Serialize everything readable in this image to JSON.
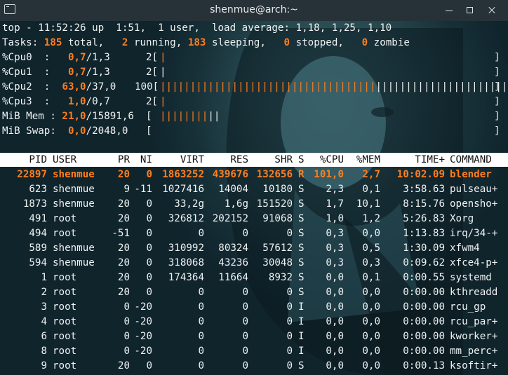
{
  "window": {
    "title": "shenmue@arch:~"
  },
  "summary": {
    "line1": "top - 11:52:26 up  1:51,  1 user,  load average: 1,18, 1,25, 1,10",
    "tasks_label": "Tasks:",
    "tasks_total": "185",
    "tasks_total_label": "total,",
    "tasks_running": "2",
    "tasks_running_label": "running,",
    "tasks_sleeping": "183",
    "tasks_sleeping_label": "sleeping,",
    "tasks_stopped": "0",
    "tasks_stopped_label": "stopped,",
    "tasks_zombie": "0",
    "tasks_zombie_label": "zombie"
  },
  "cpus": [
    {
      "label": "%Cpu0  :",
      "val": "0,7",
      "rest": "/1,3",
      "total": "2",
      "usage_pct": 2
    },
    {
      "label": "%Cpu1  :",
      "val": "0,7",
      "rest": "/1,3",
      "total": "2",
      "usage_pct": 2
    },
    {
      "label": "%Cpu2  :",
      "val": "63,0",
      "rest": "/37,0",
      "total": "100",
      "usage_pct": 100
    },
    {
      "label": "%Cpu3  :",
      "val": "1,0",
      "rest": "/0,7",
      "total": "2",
      "usage_pct": 2
    }
  ],
  "mem": {
    "label": "MiB Mem :",
    "val": "21,0",
    "rest": "/15891,6"
  },
  "swap": {
    "label": "MiB Swap:",
    "val": "0,0",
    "rest": "/2048,0"
  },
  "columns": [
    "PID",
    "USER",
    "PR",
    "NI",
    "VIRT",
    "RES",
    "SHR",
    "S",
    "%CPU",
    "%MEM",
    "TIME+",
    "COMMAND"
  ],
  "processes": [
    [
      "22897",
      "shenmue",
      "20",
      "0",
      "1863252",
      "439676",
      "132656",
      "R",
      "101,0",
      "2,7",
      "10:02.09",
      "blender"
    ],
    [
      "623",
      "shenmue",
      "9",
      "-11",
      "1027416",
      "14004",
      "10180",
      "S",
      "2,3",
      "0,1",
      "3:58.63",
      "pulseau+"
    ],
    [
      "1873",
      "shenmue",
      "20",
      "0",
      "33,2g",
      "1,6g",
      "151520",
      "S",
      "1,7",
      "10,1",
      "8:15.76",
      "opensho+"
    ],
    [
      "491",
      "root",
      "20",
      "0",
      "326812",
      "202152",
      "91068",
      "S",
      "1,0",
      "1,2",
      "5:26.83",
      "Xorg"
    ],
    [
      "494",
      "root",
      "-51",
      "0",
      "0",
      "0",
      "0",
      "S",
      "0,3",
      "0,0",
      "1:13.83",
      "irq/34-+"
    ],
    [
      "589",
      "shenmue",
      "20",
      "0",
      "310992",
      "80324",
      "57612",
      "S",
      "0,3",
      "0,5",
      "1:30.09",
      "xfwm4"
    ],
    [
      "594",
      "shenmue",
      "20",
      "0",
      "318068",
      "43236",
      "30048",
      "S",
      "0,3",
      "0,3",
      "0:09.62",
      "xfce4-p+"
    ],
    [
      "1",
      "root",
      "20",
      "0",
      "174364",
      "11664",
      "8932",
      "S",
      "0,0",
      "0,1",
      "0:00.55",
      "systemd"
    ],
    [
      "2",
      "root",
      "20",
      "0",
      "0",
      "0",
      "0",
      "S",
      "0,0",
      "0,0",
      "0:00.00",
      "kthreadd"
    ],
    [
      "3",
      "root",
      "0",
      "-20",
      "0",
      "0",
      "0",
      "I",
      "0,0",
      "0,0",
      "0:00.00",
      "rcu_gp"
    ],
    [
      "4",
      "root",
      "0",
      "-20",
      "0",
      "0",
      "0",
      "I",
      "0,0",
      "0,0",
      "0:00.00",
      "rcu_par+"
    ],
    [
      "6",
      "root",
      "0",
      "-20",
      "0",
      "0",
      "0",
      "I",
      "0,0",
      "0,0",
      "0:00.00",
      "kworker+"
    ],
    [
      "8",
      "root",
      "0",
      "-20",
      "0",
      "0",
      "0",
      "I",
      "0,0",
      "0,0",
      "0:00.00",
      "mm_perc+"
    ],
    [
      "9",
      "root",
      "20",
      "0",
      "0",
      "0",
      "0",
      "S",
      "0,0",
      "0,0",
      "0:00.13",
      "ksoftir+"
    ]
  ],
  "colors": {
    "accent": "#ff7e1f",
    "header_bg": "#ffffff",
    "titlebar": "#263238",
    "background": "#173038"
  }
}
